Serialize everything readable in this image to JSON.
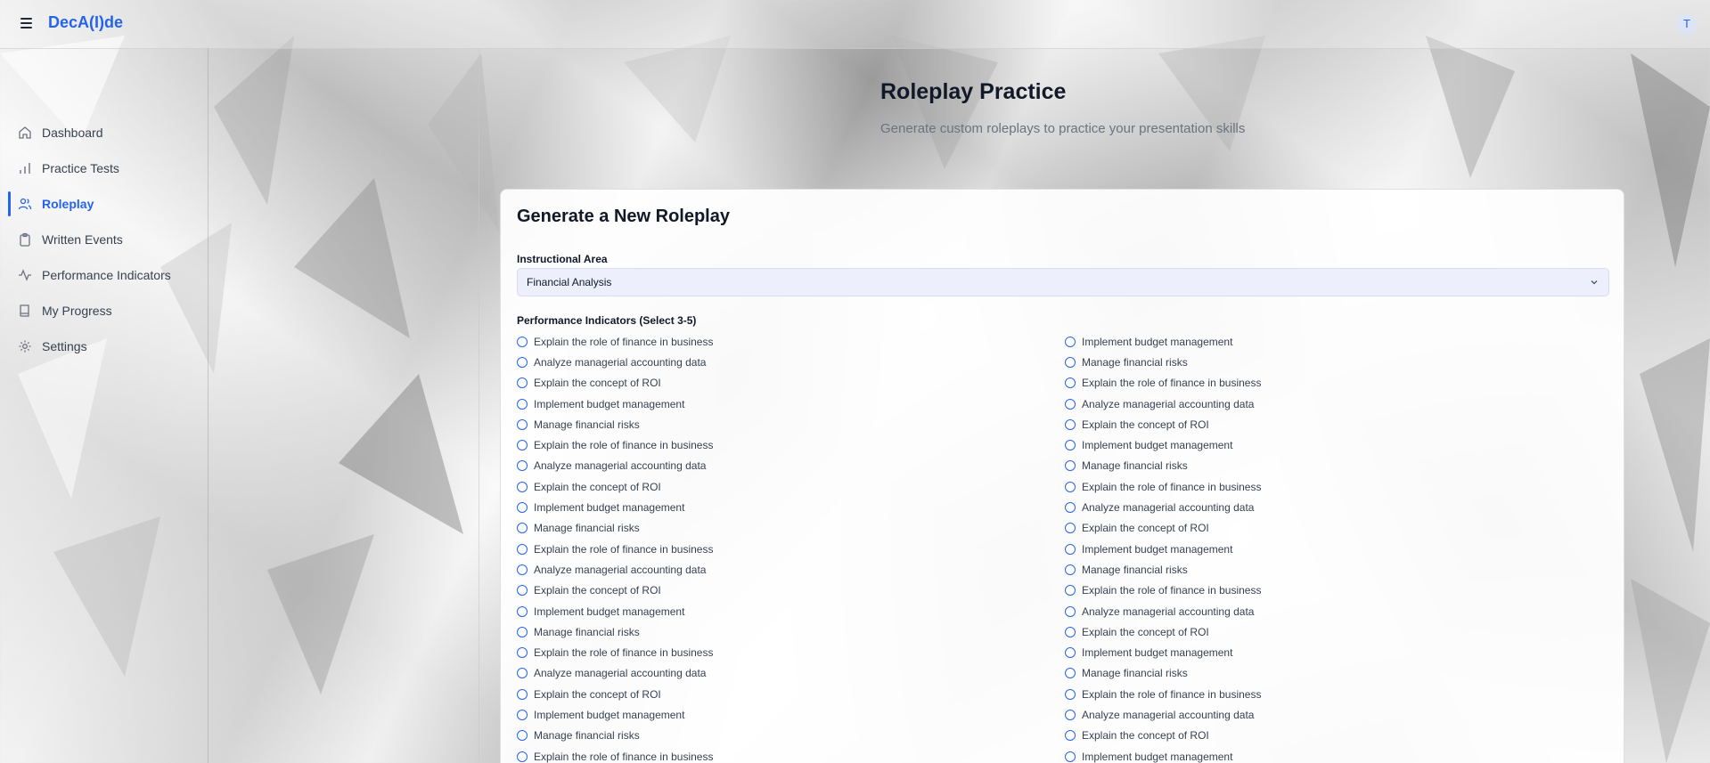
{
  "app": {
    "brand": "DecA(I)de",
    "avatar_initial": "T"
  },
  "colors": {
    "accent": "#2563eb",
    "select_bg": "#eeeffc"
  },
  "sidebar": {
    "items": [
      {
        "label": "Dashboard",
        "icon": "home-icon",
        "active": false
      },
      {
        "label": "Practice Tests",
        "icon": "bar-chart-icon",
        "active": false
      },
      {
        "label": "Roleplay",
        "icon": "users-icon",
        "active": true
      },
      {
        "label": "Written Events",
        "icon": "clipboard-icon",
        "active": false
      },
      {
        "label": "Performance Indicators",
        "icon": "activity-icon",
        "active": false
      },
      {
        "label": "My Progress",
        "icon": "book-icon",
        "active": false
      },
      {
        "label": "Settings",
        "icon": "gear-icon",
        "active": false
      }
    ]
  },
  "page": {
    "title": "Roleplay Practice",
    "subtitle": "Generate custom roleplays to practice your presentation skills"
  },
  "form": {
    "title": "Generate a New Roleplay",
    "instructional_area_label": "Instructional Area",
    "instructional_area_value": "Financial Analysis",
    "pi_label": "Performance Indicators (Select 3-5)",
    "pi_left": [
      "Explain the role of finance in business",
      "Analyze managerial accounting data",
      "Explain the concept of ROI",
      "Implement budget management",
      "Manage financial risks",
      "Explain the role of finance in business",
      "Analyze managerial accounting data",
      "Explain the concept of ROI",
      "Implement budget management",
      "Manage financial risks",
      "Explain the role of finance in business",
      "Analyze managerial accounting data",
      "Explain the concept of ROI",
      "Implement budget management",
      "Manage financial risks",
      "Explain the role of finance in business",
      "Analyze managerial accounting data",
      "Explain the concept of ROI",
      "Implement budget management",
      "Manage financial risks",
      "Explain the role of finance in business"
    ],
    "pi_right": [
      "Implement budget management",
      "Manage financial risks",
      "Explain the role of finance in business",
      "Analyze managerial accounting data",
      "Explain the concept of ROI",
      "Implement budget management",
      "Manage financial risks",
      "Explain the role of finance in business",
      "Analyze managerial accounting data",
      "Explain the concept of ROI",
      "Implement budget management",
      "Manage financial risks",
      "Explain the role of finance in business",
      "Analyze managerial accounting data",
      "Explain the concept of ROI",
      "Implement budget management",
      "Manage financial risks",
      "Explain the role of finance in business",
      "Analyze managerial accounting data",
      "Explain the concept of ROI",
      "Implement budget management"
    ]
  }
}
